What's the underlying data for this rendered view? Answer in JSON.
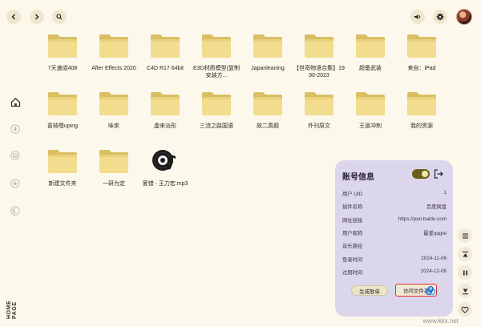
{
  "topbar": {
    "back_icon": "chevron-left-icon",
    "forward_icon": "chevron-right-icon",
    "search_icon": "search-icon",
    "volume_icon": "volume-icon",
    "settings_icon": "gear-icon"
  },
  "rail": {
    "items": [
      {
        "icon": "home-icon",
        "active": true
      },
      {
        "icon": "flame-icon",
        "active": false
      },
      {
        "icon": "image-icon",
        "active": false
      },
      {
        "icon": "star-icon",
        "active": false
      },
      {
        "icon": "moon-icon",
        "active": false
      }
    ],
    "label": "HOME PAGE"
  },
  "files": [
    {
      "name": "7天速成408",
      "type": "folder"
    },
    {
      "name": "After Effects 2020",
      "type": "folder"
    },
    {
      "name": "C4D R17 64bit",
      "type": "folder"
    },
    {
      "name": "E3D材质模型(复制安装方...",
      "type": "folder"
    },
    {
      "name": "Japanleaning",
      "type": "folder"
    },
    {
      "name": "【世奇物语合集】1990-2023",
      "type": "folder"
    },
    {
      "name": "超备武装",
      "type": "folder"
    },
    {
      "name": "来自：iPad",
      "type": "folder"
    },
    {
      "name": "喜枝嗯uping",
      "type": "folder"
    },
    {
      "name": "咏柰",
      "type": "folder"
    },
    {
      "name": "虚来派形",
      "type": "folder"
    },
    {
      "name": "三流之路国语",
      "type": "folder"
    },
    {
      "name": "故二真题",
      "type": "folder"
    },
    {
      "name": "外刊原文",
      "type": "folder"
    },
    {
      "name": "王道冲刺",
      "type": "folder"
    },
    {
      "name": "我的资源",
      "type": "folder"
    },
    {
      "name": "新建文件夹",
      "type": "folder"
    },
    {
      "name": "一研为定",
      "type": "folder"
    },
    {
      "name": "爱错 - 王力宏.mp3",
      "type": "music"
    }
  ],
  "panel": {
    "title": "账号信息",
    "toggle_on": true,
    "rows": [
      {
        "key": "用户 UID",
        "value": "1"
      },
      {
        "key": "插件名称",
        "value": "百度网盘"
      },
      {
        "key": "网址链接",
        "value": "https://pan.baidu.com"
      },
      {
        "key": "用户昵称",
        "value": "最爱qqqre"
      },
      {
        "key": "音乐路径",
        "value": ""
      },
      {
        "key": "登录时间",
        "value": "2024-11-06"
      },
      {
        "key": "过期时间",
        "value": "2024-12-06"
      }
    ],
    "button_generate": "生成歌单",
    "button_open_folder": "访问文件夹"
  },
  "right_rail": {
    "list_icon": "list-icon",
    "top_icon": "to-top-icon",
    "pause_icon": "pause-icon",
    "bottom_icon": "to-bottom-icon",
    "heart_icon": "heart-icon"
  },
  "watermark": "www.kkx.net",
  "colors": {
    "background": "#fcf8ec",
    "folder": "#f2dc8e",
    "folder_dark": "#d9be62",
    "panel": "#dcd6ec",
    "highlight": "#e03030"
  }
}
